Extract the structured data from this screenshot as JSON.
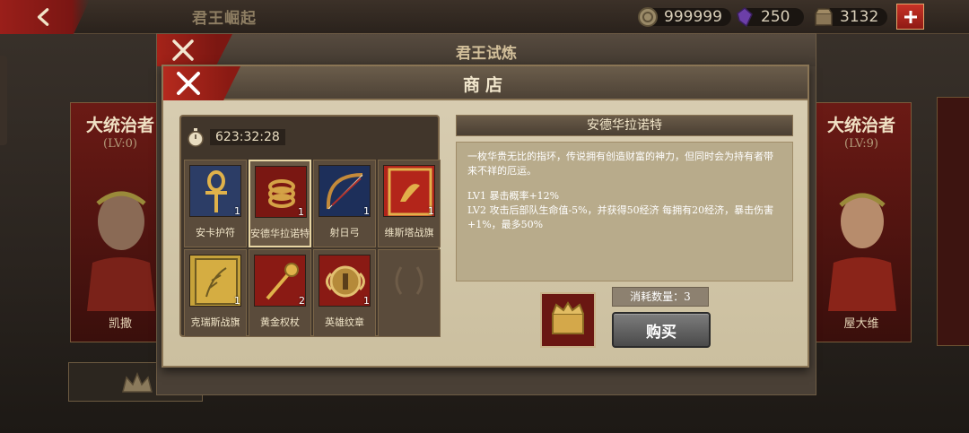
{
  "topbar": {
    "title": "君王崛起",
    "coins": "999999",
    "gems": "250",
    "supplies": "3132"
  },
  "side_left": {
    "rank": "大统治者",
    "level": "(LV:0)",
    "name": "凯撒"
  },
  "side_right": {
    "rank": "大统治者",
    "level": "(LV:9)",
    "name": "屋大维"
  },
  "back_dialog": {
    "title": "君王试炼"
  },
  "shop": {
    "title": "商店",
    "timer": "623:32:28",
    "items": [
      {
        "label": "安卡护符",
        "qty": "1",
        "icon": "ankh-amulet-icon"
      },
      {
        "label": "安德华拉诺特",
        "qty": "1",
        "icon": "serpent-ring-icon",
        "selected": true
      },
      {
        "label": "射日弓",
        "qty": "1",
        "icon": "bow-icon"
      },
      {
        "label": "维斯塔战旗",
        "qty": "1",
        "icon": "vesta-banner-icon"
      },
      {
        "label": "克瑞斯战旗",
        "qty": "1",
        "icon": "ceres-banner-icon"
      },
      {
        "label": "黄金权杖",
        "qty": "2",
        "icon": "golden-scepter-icon"
      },
      {
        "label": "英雄纹章",
        "qty": "1",
        "icon": "hero-emblem-icon"
      },
      {
        "label": "",
        "qty": "",
        "icon": "laurel-placeholder-icon"
      }
    ],
    "detail": {
      "name": "安德华拉诺特",
      "description": "一枚华贵无比的指环，传说拥有创造财富的神力，但同时会为持有者带来不祥的厄运。",
      "lv1": "LV1 暴击概率+12%",
      "lv2": "LV2 攻击后部队生命值-5%，并获得50经济 每拥有20经济，暴击伤害+1%，最多50%"
    },
    "cost_label": "消耗数量：3",
    "buy_label": "购买",
    "currency_icon": "crown-coin-icon"
  },
  "colors": {
    "accent_red": "#a52319",
    "panel_parchment": "#d9ceb3",
    "panel_dark": "#41362b"
  }
}
